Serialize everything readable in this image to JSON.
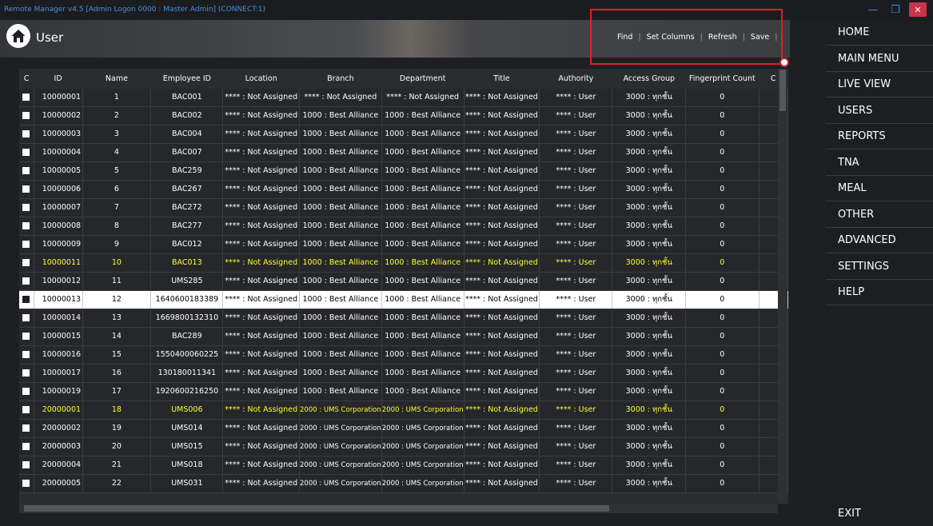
{
  "window": {
    "title": "Remote Manager v4.5 [Admin Logon 0000 : Master Admin] (CONNECT:1)"
  },
  "header": {
    "title": "User"
  },
  "toolbar": {
    "find": "Find",
    "set_columns": "Set Columns",
    "refresh": "Refresh",
    "save": "Save"
  },
  "colors": {
    "accent_yellow": "#ffff2e",
    "highlight_red": "#e01f27",
    "title_blue": "#4a8fd8",
    "close_red": "#c9344a"
  },
  "grid": {
    "columns": [
      "C",
      "ID",
      "Name",
      "Employee ID",
      "Location",
      "Branch",
      "Department",
      "Title",
      "Authority",
      "Access Group",
      "Fingerprint Count",
      "C"
    ],
    "rows": [
      {
        "id": "10000001",
        "name": "1",
        "emp": "BAC001",
        "loc": "**** : Not Assigned",
        "branch": "**** : Not Assigned",
        "dept": "**** : Not Assigned",
        "title": "**** : Not Assigned",
        "auth": "**** : User",
        "group": "3000 : ทุกชั้น",
        "fp": "0",
        "style": "normal"
      },
      {
        "id": "10000002",
        "name": "2",
        "emp": "BAC002",
        "loc": "**** : Not Assigned",
        "branch": "1000 : Best Alliance",
        "dept": "1000 : Best Alliance",
        "title": "**** : Not Assigned",
        "auth": "**** : User",
        "group": "3000 : ทุกชั้น",
        "fp": "0",
        "style": "normal"
      },
      {
        "id": "10000003",
        "name": "3",
        "emp": "BAC004",
        "loc": "**** : Not Assigned",
        "branch": "1000 : Best Alliance",
        "dept": "1000 : Best Alliance",
        "title": "**** : Not Assigned",
        "auth": "**** : User",
        "group": "3000 : ทุกชั้น",
        "fp": "0",
        "style": "normal"
      },
      {
        "id": "10000004",
        "name": "4",
        "emp": "BAC007",
        "loc": "**** : Not Assigned",
        "branch": "1000 : Best Alliance",
        "dept": "1000 : Best Alliance",
        "title": "**** : Not Assigned",
        "auth": "**** : User",
        "group": "3000 : ทุกชั้น",
        "fp": "0",
        "style": "normal"
      },
      {
        "id": "10000005",
        "name": "5",
        "emp": "BAC259",
        "loc": "**** : Not Assigned",
        "branch": "1000 : Best Alliance",
        "dept": "1000 : Best Alliance",
        "title": "**** : Not Assigned",
        "auth": "**** : User",
        "group": "3000 : ทุกชั้น",
        "fp": "0",
        "style": "normal"
      },
      {
        "id": "10000006",
        "name": "6",
        "emp": "BAC267",
        "loc": "**** : Not Assigned",
        "branch": "1000 : Best Alliance",
        "dept": "1000 : Best Alliance",
        "title": "**** : Not Assigned",
        "auth": "**** : User",
        "group": "3000 : ทุกชั้น",
        "fp": "0",
        "style": "normal"
      },
      {
        "id": "10000007",
        "name": "7",
        "emp": "BAC272",
        "loc": "**** : Not Assigned",
        "branch": "1000 : Best Alliance",
        "dept": "1000 : Best Alliance",
        "title": "**** : Not Assigned",
        "auth": "**** : User",
        "group": "3000 : ทุกชั้น",
        "fp": "0",
        "style": "normal"
      },
      {
        "id": "10000008",
        "name": "8",
        "emp": "BAC277",
        "loc": "**** : Not Assigned",
        "branch": "1000 : Best Alliance",
        "dept": "1000 : Best Alliance",
        "title": "**** : Not Assigned",
        "auth": "**** : User",
        "group": "3000 : ทุกชั้น",
        "fp": "0",
        "style": "normal"
      },
      {
        "id": "10000009",
        "name": "9",
        "emp": "BAC012",
        "loc": "**** : Not Assigned",
        "branch": "1000 : Best Alliance",
        "dept": "1000 : Best Alliance",
        "title": "**** : Not Assigned",
        "auth": "**** : User",
        "group": "3000 : ทุกชั้น",
        "fp": "0",
        "style": "normal"
      },
      {
        "id": "10000011",
        "name": "10",
        "emp": "BAC013",
        "loc": "**** : Not Assigned",
        "branch": "1000 : Best Alliance",
        "dept": "1000 : Best Alliance",
        "title": "**** : Not Assigned",
        "auth": "**** : User",
        "group": "3000 : ทุกชั้น",
        "fp": "0",
        "style": "yellow"
      },
      {
        "id": "10000012",
        "name": "11",
        "emp": "UMS285",
        "loc": "**** : Not Assigned",
        "branch": "1000 : Best Alliance",
        "dept": "1000 : Best Alliance",
        "title": "**** : Not Assigned",
        "auth": "**** : User",
        "group": "3000 : ทุกชั้น",
        "fp": "0",
        "style": "normal"
      },
      {
        "id": "10000013",
        "name": "12",
        "emp": "1640600183389",
        "loc": "**** : Not Assigned",
        "branch": "1000 : Best Alliance",
        "dept": "1000 : Best Alliance",
        "title": "**** : Not Assigned",
        "auth": "**** : User",
        "group": "3000 : ทุกชั้น",
        "fp": "0",
        "style": "selected"
      },
      {
        "id": "10000014",
        "name": "13",
        "emp": "1669800132310",
        "loc": "**** : Not Assigned",
        "branch": "1000 : Best Alliance",
        "dept": "1000 : Best Alliance",
        "title": "**** : Not Assigned",
        "auth": "**** : User",
        "group": "3000 : ทุกชั้น",
        "fp": "0",
        "style": "normal"
      },
      {
        "id": "10000015",
        "name": "14",
        "emp": "BAC289",
        "loc": "**** : Not Assigned",
        "branch": "1000 : Best Alliance",
        "dept": "1000 : Best Alliance",
        "title": "**** : Not Assigned",
        "auth": "**** : User",
        "group": "3000 : ทุกชั้น",
        "fp": "0",
        "style": "normal"
      },
      {
        "id": "10000016",
        "name": "15",
        "emp": "1550400060225",
        "loc": "**** : Not Assigned",
        "branch": "1000 : Best Alliance",
        "dept": "1000 : Best Alliance",
        "title": "**** : Not Assigned",
        "auth": "**** : User",
        "group": "3000 : ทุกชั้น",
        "fp": "0",
        "style": "normal"
      },
      {
        "id": "10000017",
        "name": "16",
        "emp": "130180011341",
        "loc": "**** : Not Assigned",
        "branch": "1000 : Best Alliance",
        "dept": "1000 : Best Alliance",
        "title": "**** : Not Assigned",
        "auth": "**** : User",
        "group": "3000 : ทุกชั้น",
        "fp": "0",
        "style": "normal"
      },
      {
        "id": "10000019",
        "name": "17",
        "emp": "1920600216250",
        "loc": "**** : Not Assigned",
        "branch": "1000 : Best Alliance",
        "dept": "1000 : Best Alliance",
        "title": "**** : Not Assigned",
        "auth": "**** : User",
        "group": "3000 : ทุกชั้น",
        "fp": "0",
        "style": "normal"
      },
      {
        "id": "20000001",
        "name": "18",
        "emp": "UMS006",
        "loc": "**** : Not Assigned",
        "branch": "2000 : UMS Corporation",
        "dept": "2000 : UMS Corporation",
        "title": "**** : Not Assigned",
        "auth": "**** : User",
        "group": "3000 : ทุกชั้น",
        "fp": "0",
        "style": "yellow"
      },
      {
        "id": "20000002",
        "name": "19",
        "emp": "UMS014",
        "loc": "**** : Not Assigned",
        "branch": "2000 : UMS Corporation",
        "dept": "2000 : UMS Corporation",
        "title": "**** : Not Assigned",
        "auth": "**** : User",
        "group": "3000 : ทุกชั้น",
        "fp": "0",
        "style": "normal"
      },
      {
        "id": "20000003",
        "name": "20",
        "emp": "UMS015",
        "loc": "**** : Not Assigned",
        "branch": "2000 : UMS Corporation",
        "dept": "2000 : UMS Corporation",
        "title": "**** : Not Assigned",
        "auth": "**** : User",
        "group": "3000 : ทุกชั้น",
        "fp": "0",
        "style": "normal"
      },
      {
        "id": "20000004",
        "name": "21",
        "emp": "UMS018",
        "loc": "**** : Not Assigned",
        "branch": "2000 : UMS Corporation",
        "dept": "2000 : UMS Corporation",
        "title": "**** : Not Assigned",
        "auth": "**** : User",
        "group": "3000 : ทุกชั้น",
        "fp": "0",
        "style": "normal"
      },
      {
        "id": "20000005",
        "name": "22",
        "emp": "UMS031",
        "loc": "**** : Not Assigned",
        "branch": "2000 : UMS Corporation",
        "dept": "2000 : UMS Corporation",
        "title": "**** : Not Assigned",
        "auth": "**** : User",
        "group": "3000 : ทุกชั้น",
        "fp": "0",
        "style": "normal"
      }
    ]
  },
  "sidebar": {
    "items": [
      "HOME",
      "MAIN MENU",
      "LIVE VIEW",
      "USERS",
      "REPORTS",
      "TNA",
      "MEAL",
      "OTHER",
      "ADVANCED",
      "SETTINGS",
      "HELP"
    ],
    "exit": "EXIT"
  }
}
